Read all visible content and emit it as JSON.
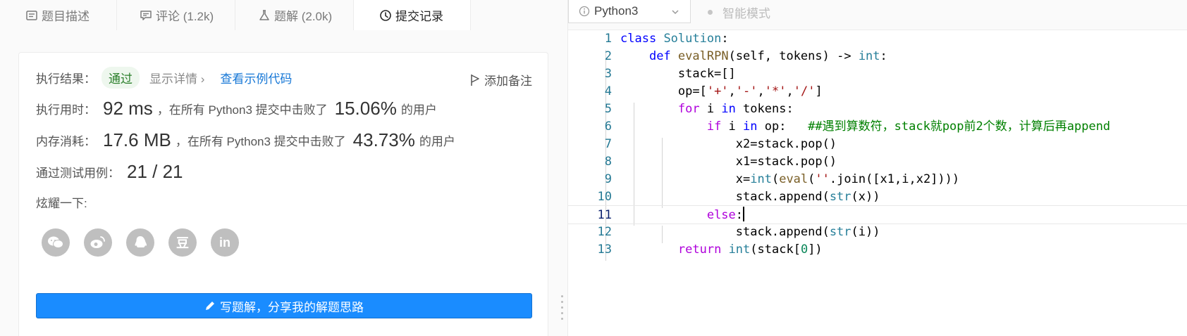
{
  "tabs": [
    {
      "label": "题目描述",
      "icon": "description-icon"
    },
    {
      "label": "评论 (1.2k)",
      "icon": "comment-icon"
    },
    {
      "label": "题解 (2.0k)",
      "icon": "flask-icon"
    },
    {
      "label": "提交记录",
      "icon": "clock-icon"
    }
  ],
  "result": {
    "label": "执行结果：",
    "status": "通过",
    "details": "显示详情 ›",
    "sample_link": "查看示例代码",
    "note": "添加备注"
  },
  "runtime": {
    "label": "执行用时：",
    "value": "92 ms",
    "text1": "，在所有 Python3 提交中击败了",
    "percent": "15.06%",
    "text2": "的用户"
  },
  "memory": {
    "label": "内存消耗：",
    "value": "17.6 MB",
    "text1": "，在所有 Python3 提交中击败了",
    "percent": "43.73%",
    "text2": "的用户"
  },
  "tests": {
    "label": "通过测试用例：",
    "value": "21 / 21"
  },
  "share": {
    "label": "炫耀一下:",
    "icons": [
      "wechat-icon",
      "weibo-icon",
      "qq-icon",
      "douban-icon",
      "linkedin-icon"
    ],
    "douban_glyph": "豆",
    "linkedin_glyph": "in"
  },
  "write_button": "写题解，分享我的解题思路",
  "editor": {
    "language": "Python3",
    "smart_mode": "智能模式",
    "current_line": 11,
    "line_numbers": [
      "1",
      "2",
      "3",
      "4",
      "5",
      "6",
      "7",
      "8",
      "9",
      "10",
      "11",
      "12",
      "13"
    ]
  },
  "colors": {
    "accent": "#1a8cff",
    "pass_green": "#2b7f2b",
    "link": "#1677d6",
    "keyword": "#0000ff",
    "comment": "#008000"
  }
}
